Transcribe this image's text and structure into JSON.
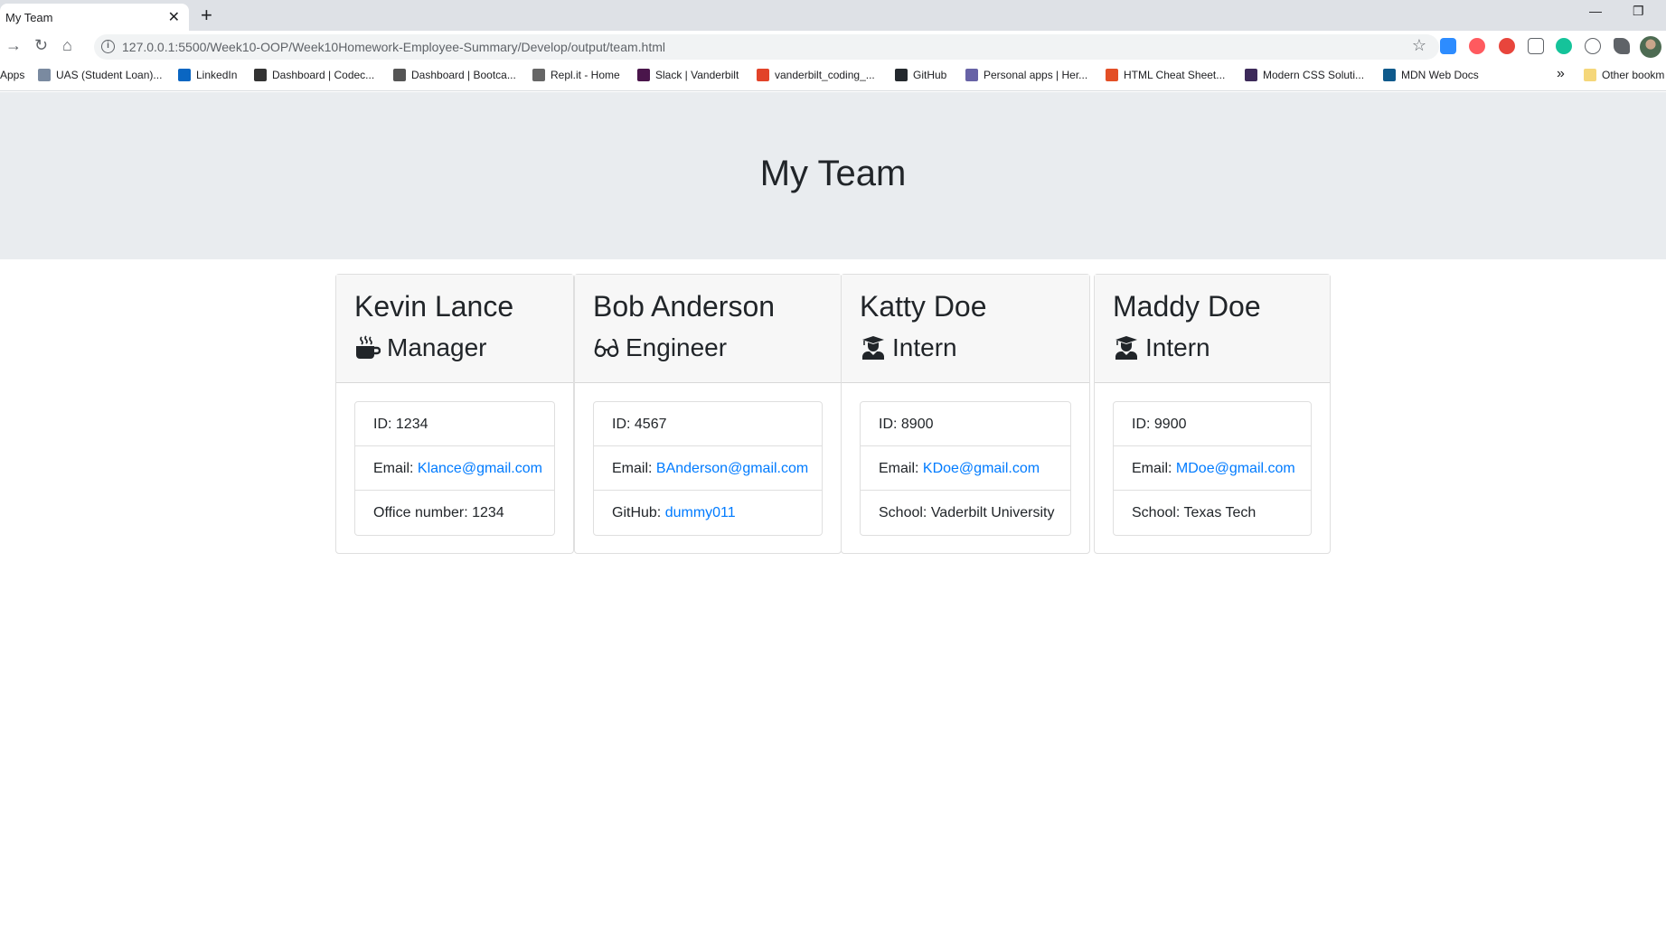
{
  "browser": {
    "tab_title": "My Team",
    "tab_close": "✕",
    "new_tab": "+",
    "url": "127.0.0.1:5500/Week10-OOP/Week10Homework-Employee-Summary/Develop/output/team.html",
    "bookmarks": [
      {
        "label": "Apps",
        "icon_color": ""
      },
      {
        "label": "UAS (Student Loan)...",
        "icon_color": "#7a8aa0"
      },
      {
        "label": "LinkedIn",
        "icon_color": "#0a66c2"
      },
      {
        "label": "Dashboard | Codec...",
        "icon_color": "#333333"
      },
      {
        "label": "Dashboard | Bootca...",
        "icon_color": "#555555"
      },
      {
        "label": "Repl.it - Home",
        "icon_color": "#666666"
      },
      {
        "label": "Slack | Vanderbilt",
        "icon_color": "#4a154b"
      },
      {
        "label": "vanderbilt_coding_...",
        "icon_color": "#e24329"
      },
      {
        "label": "GitHub",
        "icon_color": "#24292e"
      },
      {
        "label": "Personal apps | Her...",
        "icon_color": "#6762a6"
      },
      {
        "label": "HTML Cheat Sheet...",
        "icon_color": "#e34f26"
      },
      {
        "label": "Modern CSS Soluti...",
        "icon_color": "#3d2a5a"
      },
      {
        "label": "MDN Web Docs",
        "icon_color": "#0f5a8c"
      }
    ],
    "more_bookmarks": "»",
    "other_bookmarks": "Other bookm"
  },
  "page": {
    "title": "My Team"
  },
  "team": [
    {
      "name": "Kevin Lance",
      "role": "Manager",
      "icon": "mug-icon",
      "id_label": "ID: 1234",
      "email_prefix": "Email: ",
      "email": "Klance@gmail.com",
      "extra_prefix": "Office number: 1234",
      "extra_link": ""
    },
    {
      "name": "Bob Anderson",
      "role": "Engineer",
      "icon": "glasses-icon",
      "id_label": "ID: 4567",
      "email_prefix": "Email: ",
      "email": "BAnderson@gmail.com",
      "extra_prefix": "GitHub: ",
      "extra_link": "dummy011"
    },
    {
      "name": "Katty Doe",
      "role": "Intern",
      "icon": "graduate-icon",
      "id_label": "ID: 8900",
      "email_prefix": "Email: ",
      "email": "KDoe@gmail.com",
      "extra_prefix": "School: Vaderbilt University",
      "extra_link": ""
    },
    {
      "name": "Maddy Doe",
      "role": "Intern",
      "icon": "graduate-icon",
      "id_label": "ID: 9900",
      "email_prefix": "Email: ",
      "email": "MDoe@gmail.com",
      "extra_prefix": "School: Texas Tech",
      "extra_link": ""
    }
  ],
  "colors": {
    "link": "#007bff",
    "jumbotron": "#e9ecef"
  }
}
